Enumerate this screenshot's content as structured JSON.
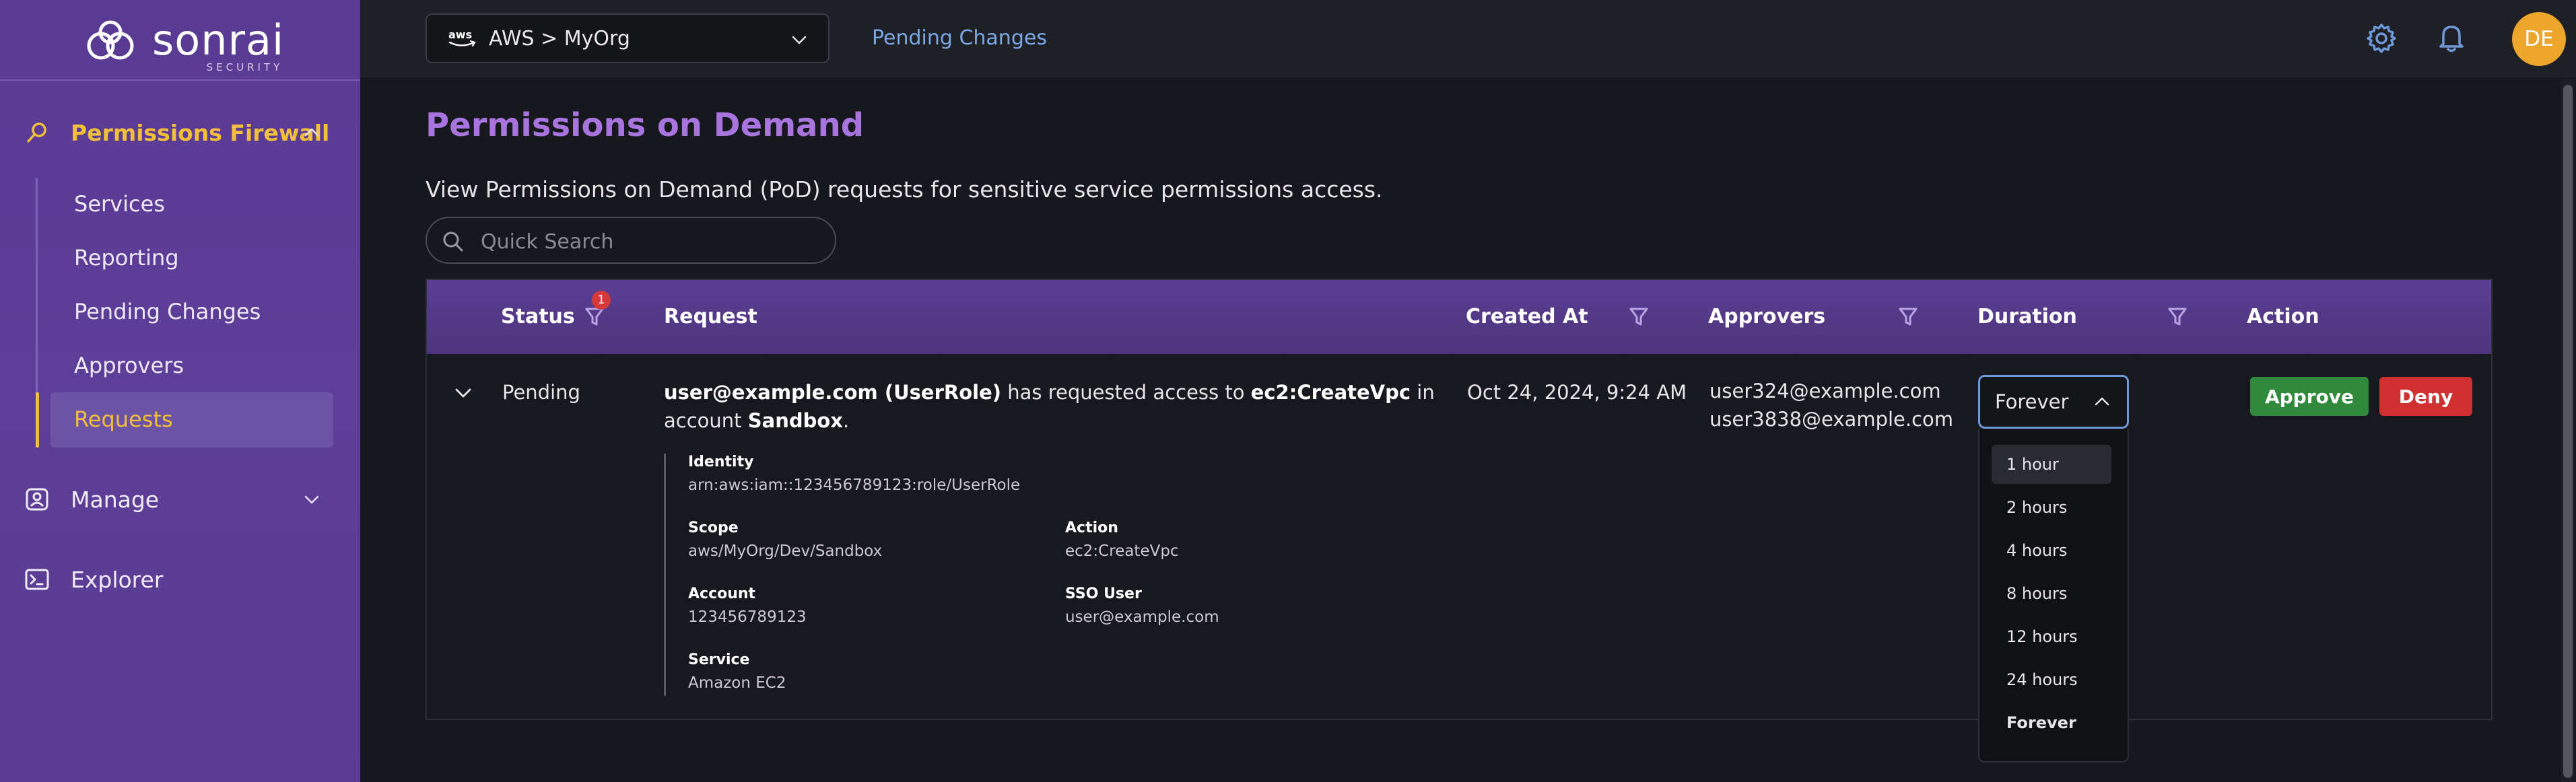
{
  "brand": {
    "name": "sonrai",
    "sub": "SECURITY"
  },
  "sidebar": {
    "sections": [
      {
        "label": "Permissions Firewall",
        "icon": "search-key-icon",
        "expanded": true
      },
      {
        "label": "Manage",
        "icon": "id-badge-icon",
        "expanded": false
      },
      {
        "label": "Explorer",
        "icon": "terminal-icon"
      }
    ],
    "items": [
      {
        "label": "Services"
      },
      {
        "label": "Reporting"
      },
      {
        "label": "Pending Changes"
      },
      {
        "label": "Approvers"
      },
      {
        "label": "Requests",
        "active": true
      }
    ]
  },
  "topbar": {
    "account_selector": {
      "provider": "aws",
      "label": "AWS > MyOrg"
    },
    "pending_link": "Pending Changes",
    "avatar": "DE"
  },
  "page": {
    "title": "Permissions on Demand",
    "description": "View Permissions on Demand (PoD) requests for sensitive service permissions access.",
    "search_placeholder": "Quick Search"
  },
  "table": {
    "columns": {
      "status": "Status",
      "status_filter_count": "1",
      "request": "Request",
      "created_at": "Created At",
      "approvers": "Approvers",
      "duration": "Duration",
      "action": "Action"
    },
    "row": {
      "status": "Pending",
      "request": {
        "user": "user@example.com (UserRole)",
        "mid1": " has requested access to ",
        "permission": "ec2:CreateVpc",
        "mid2": " in account ",
        "account": "Sandbox",
        "end": "."
      },
      "created_at": "Oct 24, 2024, 9:24 AM",
      "approvers": [
        "user324@example.com",
        "user3838@example.com"
      ],
      "duration": "Forever",
      "details": {
        "identity_label": "Identity",
        "identity": "arn:aws:iam::123456789123:role/UserRole",
        "scope_label": "Scope",
        "scope": "aws/MyOrg/Dev/Sandbox",
        "action_label": "Action",
        "action": "ec2:CreateVpc",
        "account_label": "Account",
        "account": "123456789123",
        "sso_label": "SSO User",
        "sso": "user@example.com",
        "service_label": "Service",
        "service": "Amazon EC2"
      },
      "approve_label": "Approve",
      "deny_label": "Deny"
    }
  },
  "duration_options": [
    "1 hour",
    "2 hours",
    "4 hours",
    "8 hours",
    "12 hours",
    "24 hours",
    "Forever"
  ],
  "colors": {
    "sidebar": "#5a3b94",
    "accent_gold": "#f2bf3a",
    "title_purple": "#a874de",
    "approve": "#2f8a3c",
    "deny": "#cf2f2f",
    "avatar": "#eda62c"
  }
}
